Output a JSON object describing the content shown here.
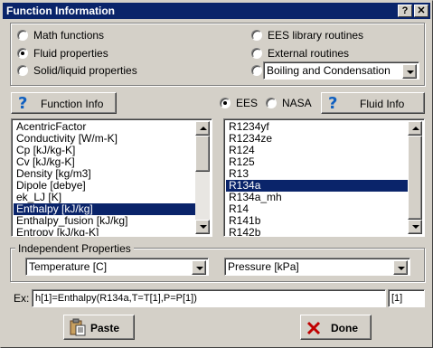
{
  "window": {
    "title": "Function Information",
    "help_glyph": "?",
    "close_glyph": "✕"
  },
  "category_options": {
    "math": "Math functions",
    "fluid": "Fluid properties",
    "solid": "Solid/liquid properties",
    "ees_library": "EES library routines",
    "external": "External routines",
    "selected": "fluid"
  },
  "category_combo": {
    "value": "Boiling and Condensation"
  },
  "function_info_button": {
    "label": "Function Info"
  },
  "source_options": {
    "ees": "EES",
    "nasa": "NASA",
    "selected": "ees"
  },
  "fluid_info_button": {
    "label": "Fluid Info"
  },
  "properties_list": {
    "items": [
      "AcentricFactor",
      "Conductivity [W/m-K]",
      "Cp [kJ/kg-K]",
      "Cv [kJ/kg-K]",
      "Density [kg/m3]",
      "Dipole [debye]",
      "ek_LJ [K]",
      "Enthalpy [kJ/kg]",
      "Enthalpy_fusion [kJ/kg]",
      "Entropy [kJ/kg-K]"
    ],
    "selected_index": 7
  },
  "fluids_list": {
    "items": [
      "R1234yf",
      "R1234ze",
      "R124",
      "R125",
      "R13",
      "R134a",
      "R134a_mh",
      "R14",
      "R141b",
      "R142b"
    ],
    "selected_index": 5
  },
  "independent": {
    "group_label": "Independent Properties",
    "first": "Temperature [C]",
    "second": "Pressure [kPa]"
  },
  "example": {
    "label": "Ex:",
    "equation": "h[1]=Enthalpy(R134a,T=T[1],P=P[1])",
    "index": "[1]"
  },
  "buttons": {
    "paste": "Paste",
    "done": "Done"
  },
  "colors": {
    "selection": "#0a246a",
    "title_bar": "#0a246a",
    "face": "#d4d0c8"
  }
}
